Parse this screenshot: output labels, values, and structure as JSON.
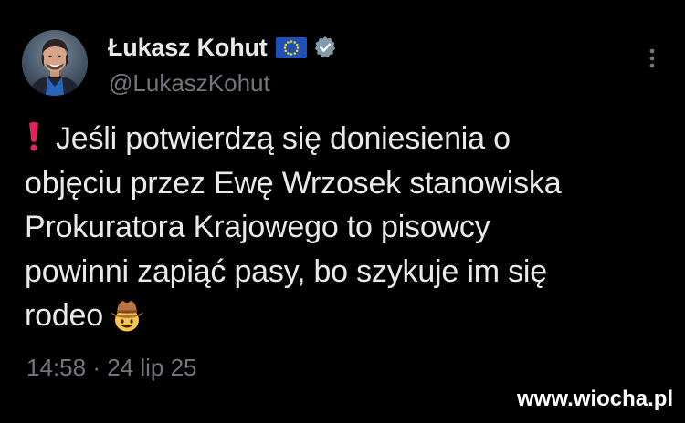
{
  "author": {
    "display_name": "Łukasz Kohut",
    "handle": "@LukaszKohut",
    "flag_icon": "eu-flag-icon",
    "verified_icon": "verified-badge-icon",
    "verified_color": "#829aab"
  },
  "tweet": {
    "text_lines": [
      "Jeśli potwierdzą się doniesienia o",
      "objęciu przez Ewę Wrzosek stanowiska",
      "Prokuratora Krajowego to pisowcy",
      "powinni zapiąć pasy, bo szykuje im się",
      "rodeo"
    ],
    "leading_icon": "red-exclamation-icon",
    "trailing_icon": "cowboy-face-emoji-icon",
    "time": "14:58",
    "separator": "·",
    "date": "24 lip 25"
  },
  "menu": {
    "icon": "more-options-icon"
  },
  "watermark": {
    "text": "www.wiocha.pl"
  },
  "colors": {
    "background": "#000000",
    "text": "#e7e9ea",
    "secondary": "#71767b",
    "alert_red": "#e0245e"
  }
}
